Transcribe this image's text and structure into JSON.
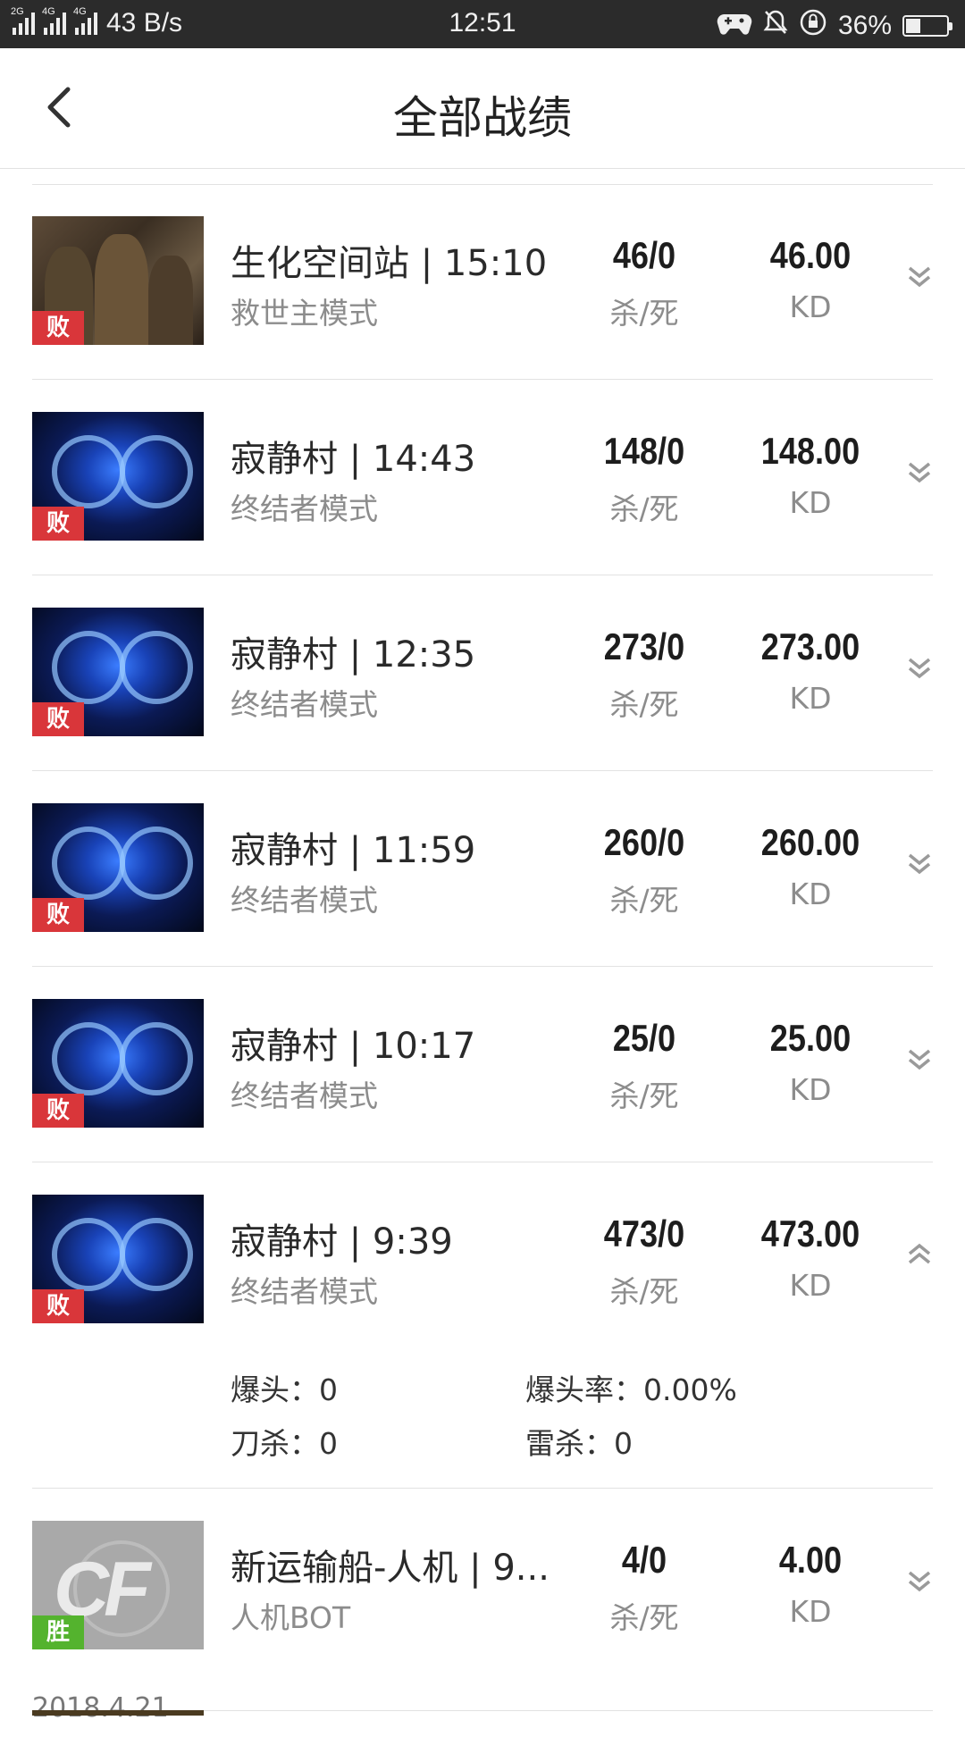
{
  "status_bar": {
    "network_speed": "43 B/s",
    "time": "12:51",
    "battery": "36%",
    "battery_level": 0.36,
    "signal_tags": [
      "2G",
      "4G",
      "4G"
    ],
    "icons": [
      "gamepad-icon",
      "bell-muted-icon",
      "rotation-lock-icon"
    ]
  },
  "header": {
    "title": "全部战绩",
    "back_icon": "chevron-left-icon"
  },
  "columns": {
    "kills_caption": "杀/死",
    "kd_caption": "KD"
  },
  "matches": [
    {
      "map_time": "生化空间站 | 15:10",
      "mode": "救世主模式",
      "kills_deaths": "46/0",
      "kd": "46.00",
      "result": "败",
      "thumb": "soldier",
      "expanded": false
    },
    {
      "map_time": "寂静村 | 14:43",
      "mode": "终结者模式",
      "kills_deaths": "148/0",
      "kd": "148.00",
      "result": "败",
      "thumb": "dark",
      "expanded": false
    },
    {
      "map_time": "寂静村 | 12:35",
      "mode": "终结者模式",
      "kills_deaths": "273/0",
      "kd": "273.00",
      "result": "败",
      "thumb": "dark",
      "expanded": false
    },
    {
      "map_time": "寂静村 | 11:59",
      "mode": "终结者模式",
      "kills_deaths": "260/0",
      "kd": "260.00",
      "result": "败",
      "thumb": "dark",
      "expanded": false
    },
    {
      "map_time": "寂静村 | 10:17",
      "mode": "终结者模式",
      "kills_deaths": "25/0",
      "kd": "25.00",
      "result": "败",
      "thumb": "dark",
      "expanded": false
    },
    {
      "map_time": "寂静村 | 9:39",
      "mode": "终结者模式",
      "kills_deaths": "473/0",
      "kd": "473.00",
      "result": "败",
      "thumb": "dark",
      "expanded": true,
      "details": {
        "headshot": "爆头：0",
        "headshot_rate": "爆头率：0.00%",
        "knife_kill": "刀杀：0",
        "grenade_kill": "雷杀：0"
      }
    },
    {
      "map_time": "新运输船-人机 | 9...",
      "mode": "人机BOT",
      "kills_deaths": "4/0",
      "kd": "4.00",
      "result": "胜",
      "thumb": "grey",
      "expanded": false
    }
  ],
  "date_separator": "2018.4.21"
}
